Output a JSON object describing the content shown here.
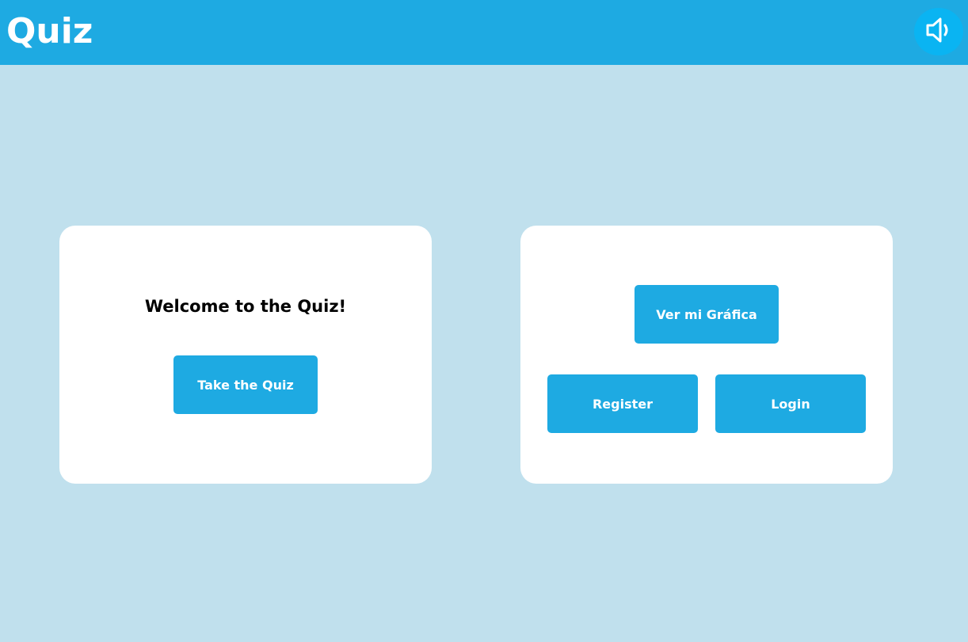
{
  "header": {
    "title": "Quiz",
    "sound_icon": "speaker-icon"
  },
  "welcome_card": {
    "heading": "Welcome to the Quiz!",
    "take_quiz_label": "Take the Quiz"
  },
  "account_card": {
    "grafica_label": "Ver mi Gráfica",
    "register_label": "Register",
    "login_label": "Login"
  },
  "colors": {
    "header_bg": "#1eaae2",
    "page_bg": "#c0e0ed",
    "button_bg": "#1eaae2",
    "sound_button_bg": "#0ab4f2",
    "card_bg": "#ffffff"
  }
}
